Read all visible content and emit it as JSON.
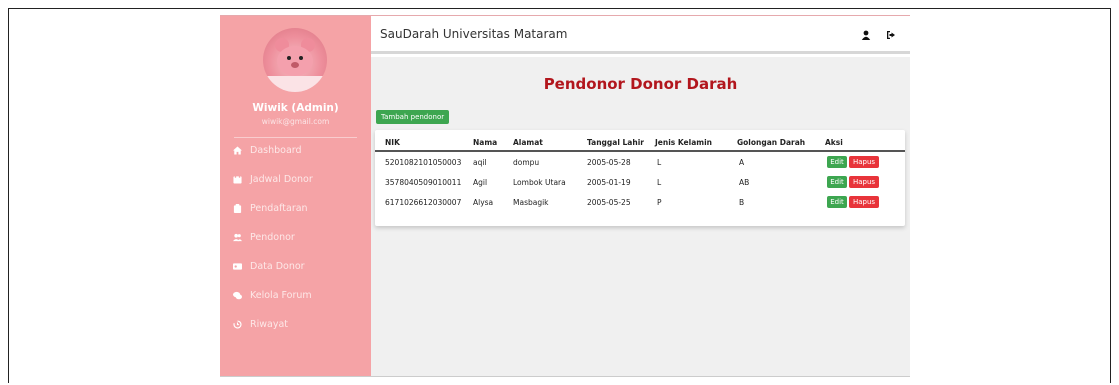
{
  "app": {
    "brand": "SauDarah Universitas Mataram"
  },
  "user": {
    "name": "Wiwik (Admin)",
    "email": "wiwik@gmail.com"
  },
  "sidebar": {
    "items": [
      {
        "label": "Dashboard",
        "icon": "home-icon"
      },
      {
        "label": "Jadwal Donor",
        "icon": "calendar-icon"
      },
      {
        "label": "Pendaftaran",
        "icon": "clipboard-icon"
      },
      {
        "label": "Pendonor",
        "icon": "users-icon"
      },
      {
        "label": "Data Donor",
        "icon": "id-card-icon"
      },
      {
        "label": "Kelola Forum",
        "icon": "comments-icon"
      },
      {
        "label": "Riwayat",
        "icon": "history-icon"
      }
    ]
  },
  "header": {
    "profile_icon": "user-icon",
    "logout_icon": "logout-icon"
  },
  "main": {
    "title": "Pendonor Donor Darah",
    "add_button": "Tambah pendonor",
    "columns": [
      "NIK",
      "Nama",
      "Alamat",
      "Tanggal Lahir",
      "Jenis Kelamin",
      "Golongan Darah",
      "Aksi"
    ],
    "rows": [
      {
        "nik": "5201082101050003",
        "nama": "aqil",
        "alamat": "dompu",
        "tanggal_lahir": "2005-05-28",
        "jenis_kelamin": "L",
        "golongan_darah": "A",
        "edit": "Edit",
        "hapus": "Hapus"
      },
      {
        "nik": "3578040509010011",
        "nama": "Agil",
        "alamat": "Lombok Utara",
        "tanggal_lahir": "2005-01-19",
        "jenis_kelamin": "L",
        "golongan_darah": "AB",
        "edit": "Edit",
        "hapus": "Hapus"
      },
      {
        "nik": "6171026612030007",
        "nama": "Alysa",
        "alamat": "Masbagik",
        "tanggal_lahir": "2005-05-25",
        "jenis_kelamin": "P",
        "golongan_darah": "B",
        "edit": "Edit",
        "hapus": "Hapus"
      }
    ]
  },
  "colors": {
    "sidebar": "#f5a3a6",
    "title": "#b2161d",
    "success": "#3da650",
    "danger": "#e8343a"
  }
}
